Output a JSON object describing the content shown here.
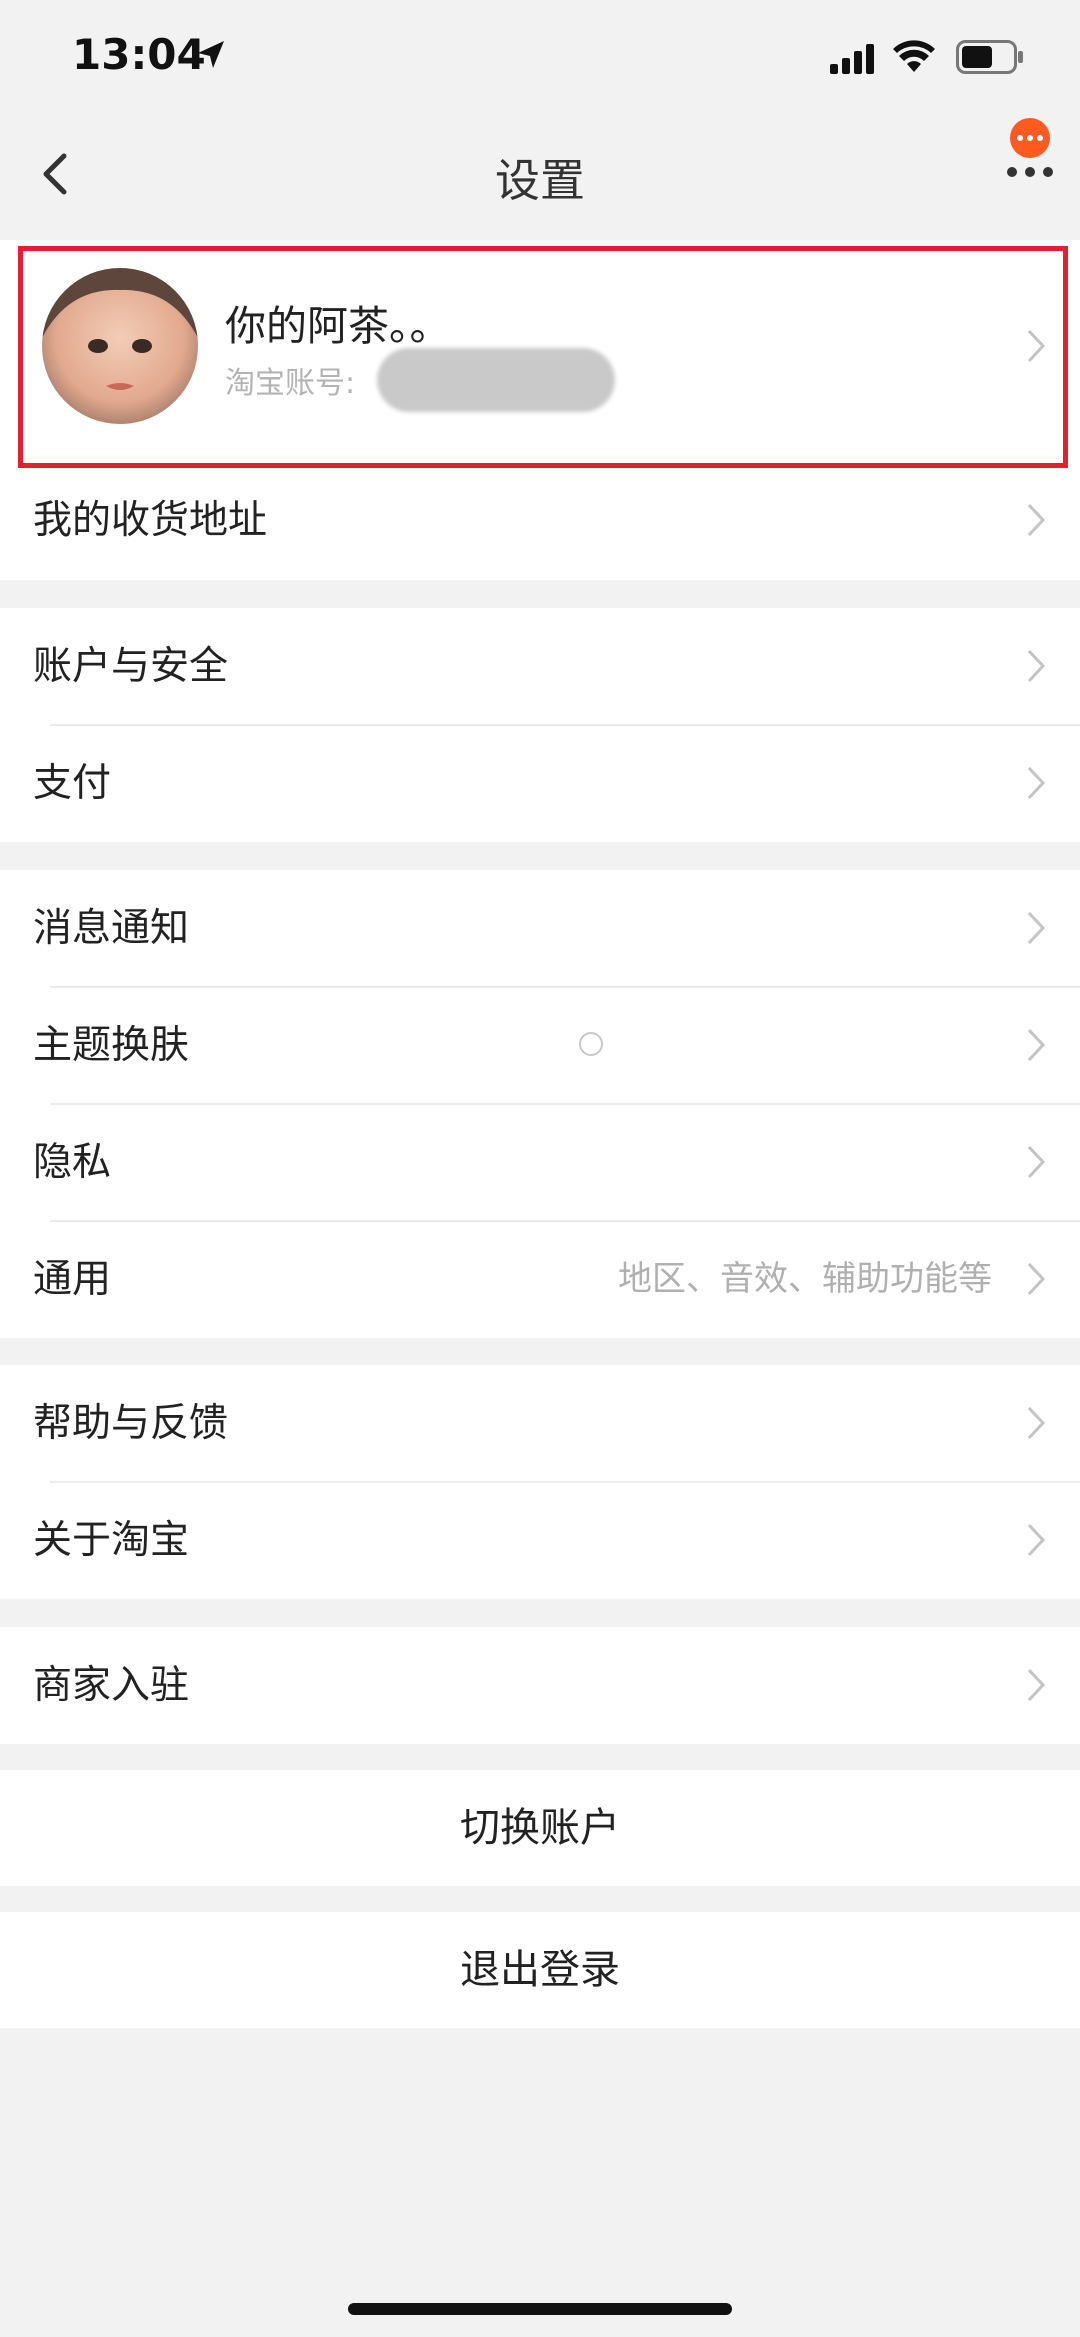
{
  "status_bar": {
    "time": "13:04"
  },
  "nav": {
    "title": "设置"
  },
  "profile": {
    "name": "你的阿茶。。",
    "account_label": "淘宝账号:"
  },
  "sections": {
    "address": "我的收货地址",
    "account_security": "账户与安全",
    "payment": "支付",
    "notifications": "消息通知",
    "theme": "主题换肤",
    "privacy": "隐私",
    "general": "通用",
    "general_hint": "地区、音效、辅助功能等",
    "help": "帮助与反馈",
    "about": "关于淘宝",
    "merchant": "商家入驻"
  },
  "actions": {
    "switch_account": "切换账户",
    "logout": "退出登录"
  },
  "colors": {
    "accent_badge": "#ff5a1f",
    "highlight_frame": "#e3202f",
    "background": "#f2f2f2"
  }
}
